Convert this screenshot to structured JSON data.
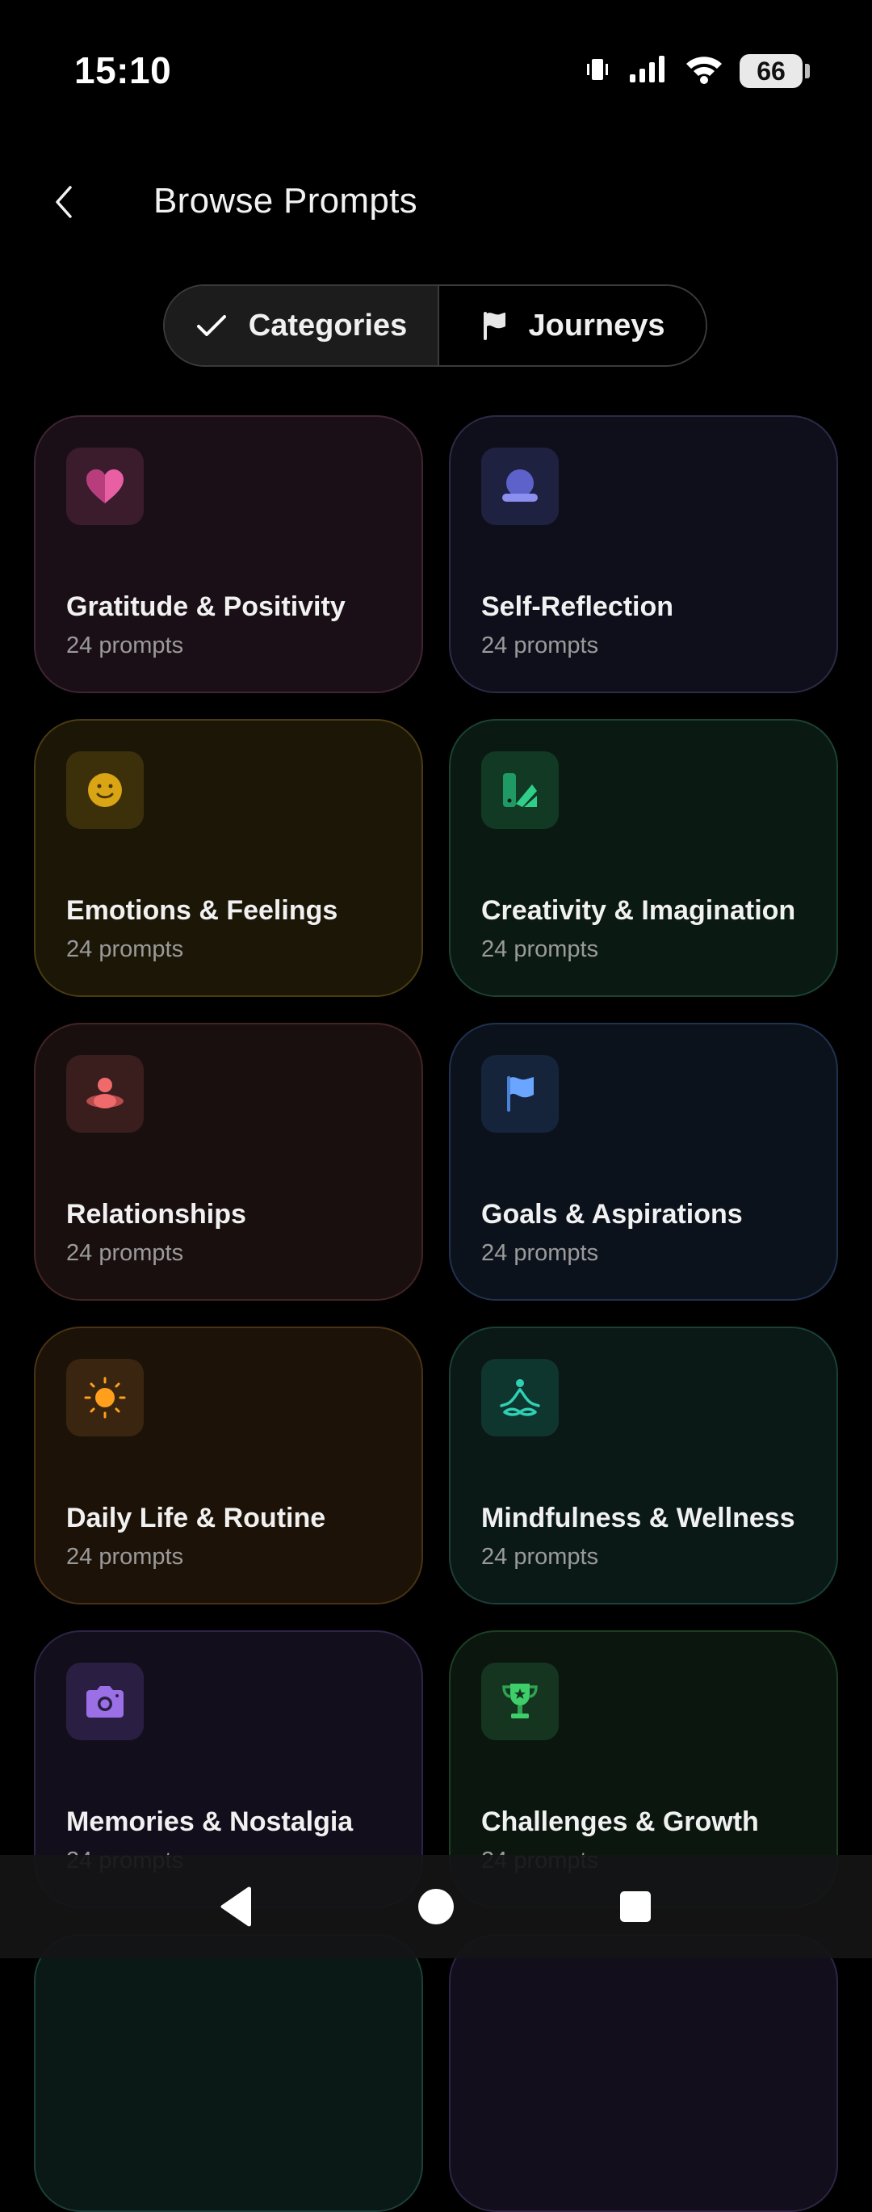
{
  "status": {
    "time": "15:10",
    "battery": "66"
  },
  "header": {
    "title": "Browse Prompts"
  },
  "tabs": {
    "categories": "Categories",
    "journeys": "Journeys"
  },
  "categories": [
    {
      "name": "Gratitude & Positivity",
      "count": "24 prompts",
      "icon": "heart-icon"
    },
    {
      "name": "Self-Reflection",
      "count": "24 prompts",
      "icon": "person-icon"
    },
    {
      "name": "Emotions & Feelings",
      "count": "24 prompts",
      "icon": "smiley-icon"
    },
    {
      "name": "Creativity & Imagination",
      "count": "24 prompts",
      "icon": "palette-icon"
    },
    {
      "name": "Relationships",
      "count": "24 prompts",
      "icon": "people-icon"
    },
    {
      "name": "Goals & Aspirations",
      "count": "24 prompts",
      "icon": "flag-icon"
    },
    {
      "name": "Daily Life & Routine",
      "count": "24 prompts",
      "icon": "sun-icon"
    },
    {
      "name": "Mindfulness & Wellness",
      "count": "24 prompts",
      "icon": "meditation-icon"
    },
    {
      "name": "Memories & Nostalgia",
      "count": "24 prompts",
      "icon": "camera-icon"
    },
    {
      "name": "Challenges & Growth",
      "count": "24 prompts",
      "icon": "trophy-icon"
    }
  ],
  "colors": {
    "background": "#000000",
    "pink": "#e85fa3",
    "indigo": "#8a8ff0",
    "amber": "#d9a514",
    "green": "#2fcf8a",
    "red": "#ef6b6b",
    "blue": "#6aa6ff",
    "orange": "#ff9f1c",
    "teal": "#2fd0b4",
    "purple": "#9b6fe6",
    "lime": "#3fcf6a"
  }
}
